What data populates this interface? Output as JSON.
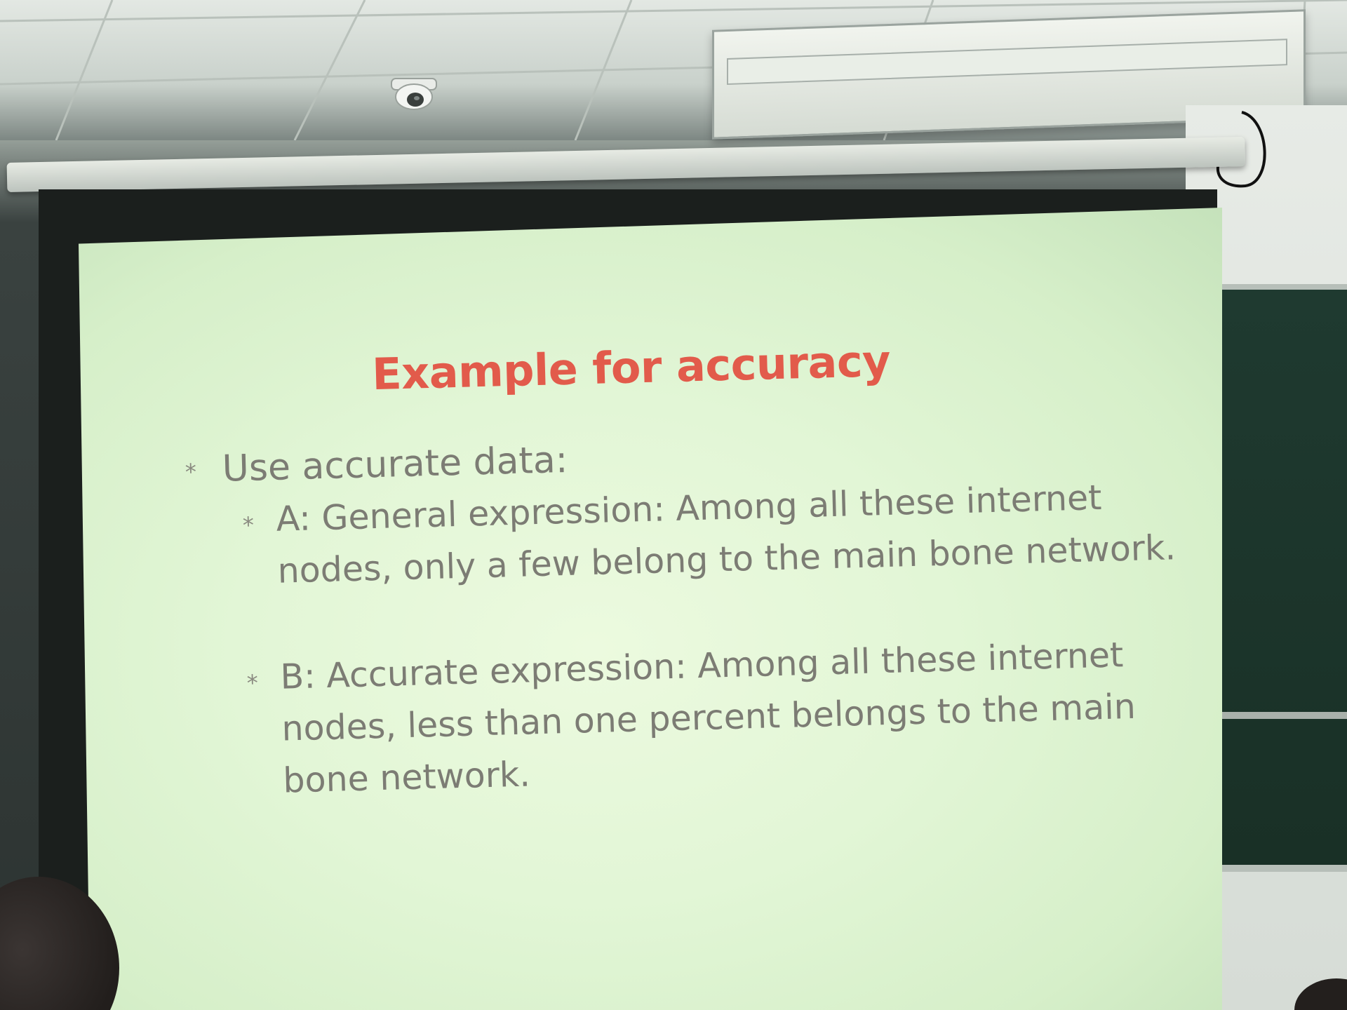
{
  "slide": {
    "title": "Example for accuracy",
    "bullet_1": "Use accurate data:",
    "bullet_a_line_1": "A: General expression: Among all these internet",
    "bullet_a_line_2": "nodes, only a few belong to the main bone network.",
    "bullet_b_line_1": "B: Accurate expression: Among all these internet",
    "bullet_b_line_2": "nodes, less than one percent belongs to the main",
    "bullet_b_line_3": "bone network.",
    "bullet_glyph": "*"
  },
  "colors": {
    "title": "#e25b4b",
    "body_text": "#7c7c74",
    "screen": "#e2f6d6",
    "chalkboard": "#1f3a30"
  }
}
